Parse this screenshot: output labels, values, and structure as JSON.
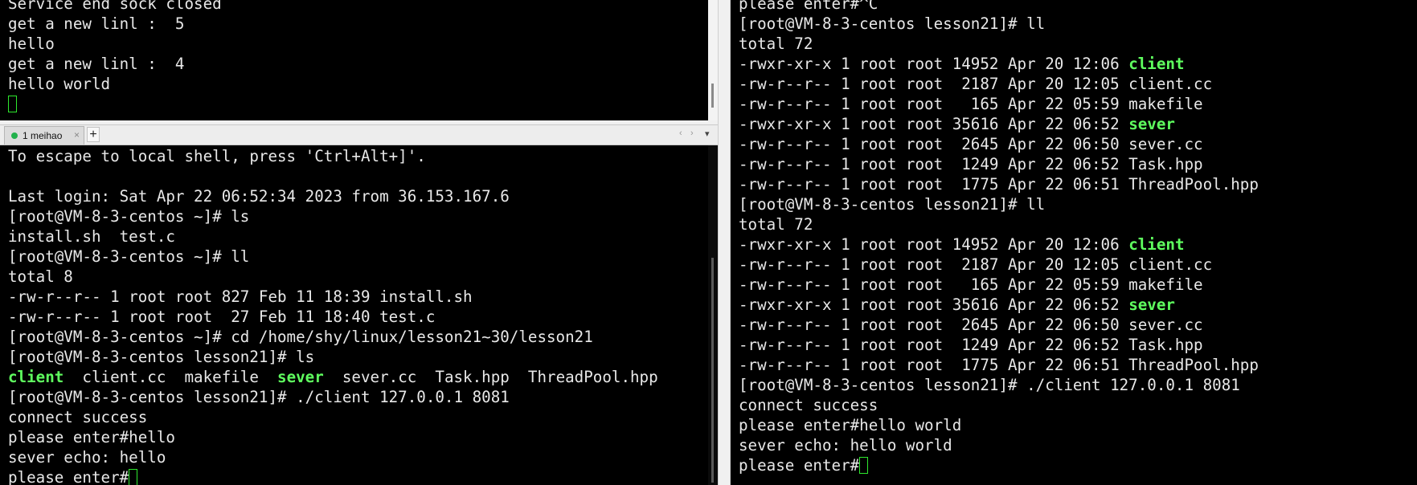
{
  "pane_top": {
    "lines": [
      [
        {
          "t": "Service end sock closed"
        }
      ],
      [
        {
          "t": "get a new linl :  5"
        }
      ],
      [
        {
          "t": "hello"
        }
      ],
      [
        {
          "t": "get a new linl :  4"
        }
      ],
      [
        {
          "t": "hello world"
        }
      ],
      [
        {
          "t": "",
          "cursor": true
        }
      ]
    ]
  },
  "tabbar": {
    "tab_label": "1 meihao",
    "tab_close": "×",
    "add_label": "+",
    "prev_label": "‹",
    "next_label": "›",
    "menu_label": "▾"
  },
  "pane_bottom": {
    "lines": [
      [
        {
          "t": "To escape to local shell, press 'Ctrl+Alt+]'."
        }
      ],
      [
        {
          "t": ""
        }
      ],
      [
        {
          "t": "Last login: Sat Apr 22 06:52:34 2023 from 36.153.167.6"
        }
      ],
      [
        {
          "t": "[root@VM-8-3-centos ~]# ls"
        }
      ],
      [
        {
          "t": "install.sh  test.c"
        }
      ],
      [
        {
          "t": "[root@VM-8-3-centos ~]# ll"
        }
      ],
      [
        {
          "t": "total 8"
        }
      ],
      [
        {
          "t": "-rw-r--r-- 1 root root 827 Feb 11 18:39 install.sh"
        }
      ],
      [
        {
          "t": "-rw-r--r-- 1 root root  27 Feb 11 18:40 test.c"
        }
      ],
      [
        {
          "t": "[root@VM-8-3-centos ~]# cd /home/shy/linux/lesson21~30/lesson21"
        }
      ],
      [
        {
          "t": "[root@VM-8-3-centos lesson21]# ls"
        }
      ],
      [
        {
          "t": "client",
          "hl": true
        },
        {
          "t": "  client.cc  makefile  "
        },
        {
          "t": "sever",
          "hl": true
        },
        {
          "t": "  sever.cc  Task.hpp  ThreadPool.hpp"
        }
      ],
      [
        {
          "t": "[root@VM-8-3-centos lesson21]# ./client 127.0.0.1 8081"
        }
      ],
      [
        {
          "t": "connect success"
        }
      ],
      [
        {
          "t": "please enter#hello"
        }
      ],
      [
        {
          "t": "sever echo: hello"
        }
      ],
      [
        {
          "t": "please enter#",
          "cursor": true
        }
      ]
    ]
  },
  "pane_right": {
    "lines": [
      [
        {
          "t": "please enter#^C"
        }
      ],
      [
        {
          "t": "[root@VM-8-3-centos lesson21]# ll"
        }
      ],
      [
        {
          "t": "total 72"
        }
      ],
      [
        {
          "t": "-rwxr-xr-x 1 root root 14952 Apr 20 12:06 "
        },
        {
          "t": "client",
          "hl": true
        }
      ],
      [
        {
          "t": "-rw-r--r-- 1 root root  2187 Apr 20 12:05 client.cc"
        }
      ],
      [
        {
          "t": "-rw-r--r-- 1 root root   165 Apr 22 05:59 makefile"
        }
      ],
      [
        {
          "t": "-rwxr-xr-x 1 root root 35616 Apr 22 06:52 "
        },
        {
          "t": "sever",
          "hl": true
        }
      ],
      [
        {
          "t": "-rw-r--r-- 1 root root  2645 Apr 22 06:50 sever.cc"
        }
      ],
      [
        {
          "t": "-rw-r--r-- 1 root root  1249 Apr 22 06:52 Task.hpp"
        }
      ],
      [
        {
          "t": "-rw-r--r-- 1 root root  1775 Apr 22 06:51 ThreadPool.hpp"
        }
      ],
      [
        {
          "t": "[root@VM-8-3-centos lesson21]# ll"
        }
      ],
      [
        {
          "t": "total 72"
        }
      ],
      [
        {
          "t": "-rwxr-xr-x 1 root root 14952 Apr 20 12:06 "
        },
        {
          "t": "client",
          "hl": true
        }
      ],
      [
        {
          "t": "-rw-r--r-- 1 root root  2187 Apr 20 12:05 client.cc"
        }
      ],
      [
        {
          "t": "-rw-r--r-- 1 root root   165 Apr 22 05:59 makefile"
        }
      ],
      [
        {
          "t": "-rwxr-xr-x 1 root root 35616 Apr 22 06:52 "
        },
        {
          "t": "sever",
          "hl": true
        }
      ],
      [
        {
          "t": "-rw-r--r-- 1 root root  2645 Apr 22 06:50 sever.cc"
        }
      ],
      [
        {
          "t": "-rw-r--r-- 1 root root  1249 Apr 22 06:52 Task.hpp"
        }
      ],
      [
        {
          "t": "-rw-r--r-- 1 root root  1775 Apr 22 06:51 ThreadPool.hpp"
        }
      ],
      [
        {
          "t": "[root@VM-8-3-centos lesson21]# ./client 127.0.0.1 8081"
        }
      ],
      [
        {
          "t": "connect success"
        }
      ],
      [
        {
          "t": "please enter#hello world"
        }
      ],
      [
        {
          "t": "sever echo: hello world"
        }
      ],
      [
        {
          "t": "please enter#",
          "cursor": true
        }
      ]
    ]
  },
  "colors": {
    "terminal_bg": "#000000",
    "terminal_fg": "#e8e8e8",
    "executable_highlight": "#5fff5f",
    "cursor": "#2ee82e",
    "tab_status_dot": "#22b14c"
  },
  "icons": {
    "tab_status": "status-dot-icon",
    "tab_close": "close-icon",
    "tab_add": "plus-icon"
  }
}
